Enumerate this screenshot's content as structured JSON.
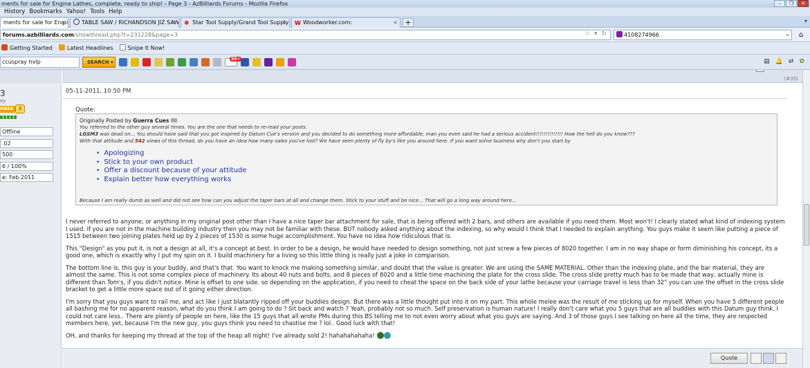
{
  "window": {
    "title": "ments for sale for Engine Lathes, complete, ready to ship! - Page 3 - AzBilliards Forums - Mozilla Firefox"
  },
  "menu": [
    "History",
    "Bookmarks",
    "Yahoo!",
    "Tools",
    "Help"
  ],
  "tabs": [
    {
      "label": "ments for sale for Engine..."
    },
    {
      "label": "TABLE SAW / RICHANDSON JIZ SAW ..."
    },
    {
      "label": "Star Tool Supply/Grand Tool Supply"
    },
    {
      "label": "Woodworker.com:"
    }
  ],
  "address": {
    "domain": "forums.azbilliards.com",
    "path": "/showthread.php?t=231228&page=3"
  },
  "search_bar": {
    "value": "4108274966"
  },
  "bookmarks": [
    "Getting Started",
    "Latest Headlines",
    "Snipe It Now!"
  ],
  "toolbar": {
    "search_value": "ccuspray hvlp",
    "search_label": "SEARCH",
    "badge": "59+"
  },
  "sidebar": {
    "username": "3",
    "usertitle": "ey",
    "badge": "MBER",
    "badge_level": "3",
    "status": "Offline",
    "field1": ".02",
    "field2": "500",
    "field3": "6 / 100%",
    "joined": "e: Feb 2011"
  },
  "post": {
    "number": "(#35)",
    "date": "05-11-2011, 10:50 PM",
    "quote_label": "Quote:",
    "quote_posted_by": "Originally Posted by",
    "quote_author": "Guerra Cues",
    "quote_line1": "You referred to the other guy several times. You are the one that needs to re-read your posts.",
    "quote_line2_bold": "LGSM3",
    "quote_line2_rest": " was dead on... You should have said that you got inspired by Datum Cue's version and you decided to do something more affordable, man you even said he had a serious accident!!!!!!!!!!!!!! How the hell do you know???",
    "quote_line3_a": "With that attitude and ",
    "quote_line3_num": "542",
    "quote_line3_b": " views of this thread, do you have an idea how many sales you've lost? We have seen plenty of fly by's like you around here. If you want some business why don't you start by",
    "quote_list": [
      "Apologizing",
      "Stick to your own product",
      "Offer a discount because of your attitude",
      "Explain better how everything works"
    ],
    "quote_last": "Because I am really dumb as well and did not see how can you adjust the taper bars at all and change them. Stick to your stuff and be nice... That will go a long way around here...",
    "paragraphs": [
      "I never referred to anyone, or anything in my original post other than I have a nice taper bar attachment for sale, that is being offered with 2 bars, and others are available if you need them. Most won't! I clearly stated what kind of indexing system I used. If you are not in the machine building industry then you may not be familiar with these. BUT nobody asked anything about the indexing, so why would I think that I needed to explain anything. You guys make it seem like putting a piece of 1515 between two joining plates held up by 2 pieces of 1530 is some huge accomplishment. You have no idea how ridiculous that is.",
      "This \"Design\" as you put it, is not a design at all, it's a concept at best. In order to be a design, he would have needed to design something, not just screw a few pieces of 8020 together. I am in no way shape or form diminishing his concept, its a good one, which is exactly why I put my spin on it. I build machinery for a living so this little thing is really just a joke in comparison.",
      "The bottom line is, this guy is your buddy, and that's that. You want to knock me making something similar, and doubt that the value is greater. We are using the SAME MATERIAL. Other than the indexing plate, and the bar material, they are almost the same. This is not some complex piece of machinery. Its about 40 nuts and bolts, and 8 pieces of 8020 and a little time machining the plate for the cross slide. The cross slide pretty much has to be made that way, actually mine is different than Tom's, if you didn't notice. Mine is offset to one side. so depending on the application, if you need to cheat the space on the back side of your lathe because your carriage travel is less than 32\" you can use the offset in the cross slide bracket to get a little more space out of it going either direction.",
      "I'm sorry that you guys want to rail me, and act like I just blatantly ripped off your buddies design. But there was a little thought put into it on my part. This whole melee was the result of me sticking up for myself. When you have 5 different people all bashing me for no apparent reason, what do you think I am going to do ? Sit back and watch ? Yeah, probably not so much. Self preservation is human nature! I really don't care what you 5 guys that are all buddies with this Datum guy think. I could not care less.. There are plenty of people on here, like the 15 guys that all wrote PMs during this BS telling me to not even worry about what you guys are saying. And 3 of those guys I see talking on here all the time, they are respected members here, yet, because I'm the new guy, you guys think you need to chastise me ? lol.. Good luck with that!"
    ],
    "last_line": "OH, and thanks for keeping my thread at the top of the heap all night! I've already sold 2! hahahahahaha!",
    "quote_button": "Quote"
  },
  "colors": {
    "accent_link": "#1f2fa8",
    "quote_red": "#cc0000",
    "badge_orange": "#e9a300",
    "search_button": "#f0a000"
  }
}
